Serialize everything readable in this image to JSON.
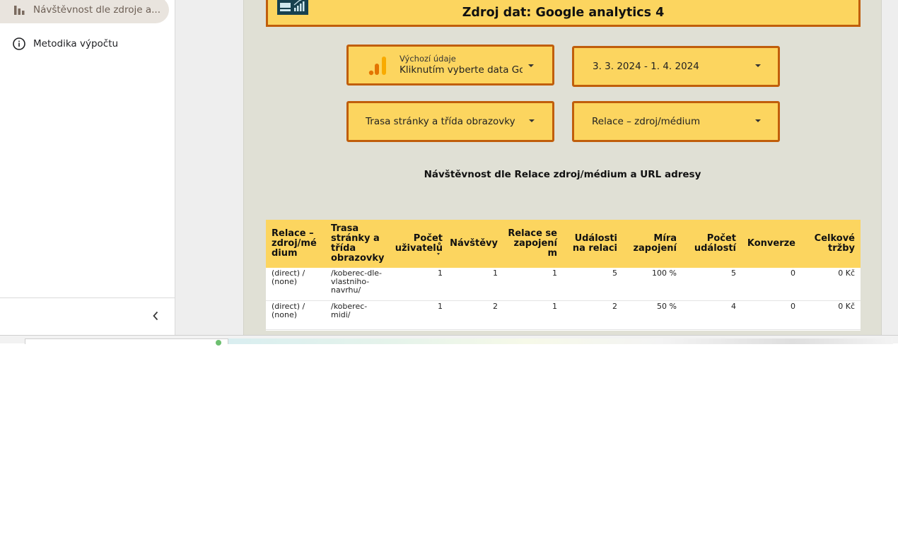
{
  "sidebar": {
    "items": [
      {
        "label": "Návštěvnost dle zdroje a...",
        "icon": "bar-chart-icon",
        "active": true
      },
      {
        "label": "Metodika výpočtu",
        "icon": "info-icon",
        "active": false
      }
    ],
    "collapse_icon": "chevron-left-icon"
  },
  "report": {
    "header_subtitle": "Zdroj dat: Google analytics 4",
    "data_source": {
      "small_label": "Výchozí údaje",
      "value": "Kliknutím vyberte data Go"
    },
    "date_range": "3. 3. 2024 - 1. 4. 2024",
    "filter_page": "Trasa stránky a třída obrazovky",
    "filter_source": "Relace – zdroj/médium",
    "table_title": "Návštěvnost dle Relace zdroj/médium a URL adresy",
    "table": {
      "headers": [
        "Relace – zdroj/mé dium",
        "Trasa stránky a třída obrazovky",
        "Počet uživatelů",
        "Návštěvy",
        "Relace se zapojení m",
        "Události na relaci",
        "Míra zapojení",
        "Počet událostí",
        "Konverze",
        "Celkové tržby"
      ],
      "rows": [
        [
          "(direct) / (none)",
          "/koberec-dle-vlastniho-navrhu/",
          "1",
          "1",
          "1",
          "5",
          "100 %",
          "5",
          "0",
          "0 Kč"
        ],
        [
          "(direct) / (none)",
          "/koberec-midi/",
          "1",
          "2",
          "1",
          "2",
          "50 %",
          "4",
          "0",
          "0 Kč"
        ]
      ]
    }
  },
  "colors": {
    "accent_fill": "#fcd55f",
    "accent_border": "#c05e0b",
    "canvas": "#e0e0d5",
    "logo_bg": "#17414f"
  }
}
